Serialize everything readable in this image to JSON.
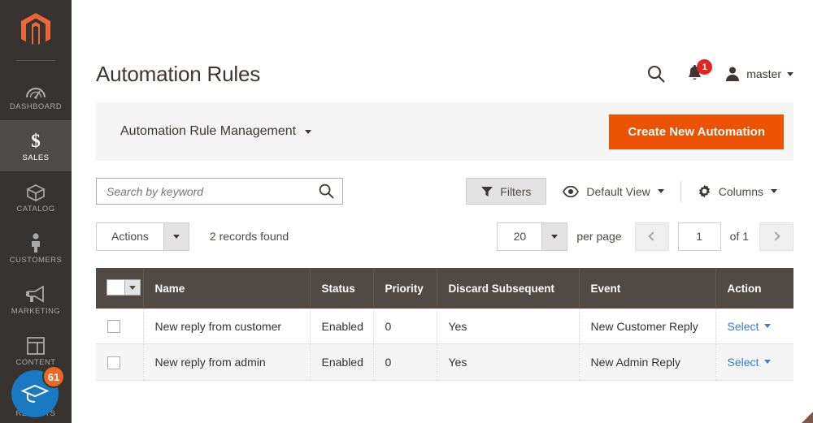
{
  "sidebar": {
    "logo_name": "magento-logo",
    "items": [
      {
        "label": "DASHBOARD",
        "icon": "gauge-icon",
        "active": false
      },
      {
        "label": "SALES",
        "icon": "dollar-icon",
        "active": true
      },
      {
        "label": "CATALOG",
        "icon": "box-icon",
        "active": false
      },
      {
        "label": "CUSTOMERS",
        "icon": "person-icon",
        "active": false
      },
      {
        "label": "MARKETING",
        "icon": "megaphone-icon",
        "active": false
      },
      {
        "label": "CONTENT",
        "icon": "layout-icon",
        "active": false
      },
      {
        "label": "REPORTS",
        "icon": "chart-icon",
        "active": false
      }
    ],
    "coach_badge": {
      "count": "61",
      "icon": "graduation-cap-icon",
      "color": "#1979c3",
      "badge_color": "#eb6726"
    }
  },
  "header": {
    "title": "Automation Rules",
    "search_icon": "search-icon",
    "notifications": {
      "icon": "bell-icon",
      "count": "1",
      "color": "#e22626"
    },
    "user": {
      "icon": "user-icon",
      "name": "master"
    }
  },
  "sub_panel": {
    "title": "Automation Rule Management",
    "create_button": "Create New Automation",
    "create_button_color": "#eb5202"
  },
  "toolbar": {
    "search_placeholder": "Search by keyword",
    "search_value": "",
    "filters_label": "Filters",
    "view_label": "Default View",
    "columns_label": "Columns"
  },
  "actions_row": {
    "actions_label": "Actions",
    "records_found": "2 records found",
    "per_page_value": "20",
    "per_page_label": "per page",
    "page_value": "1",
    "of_label": "of 1"
  },
  "grid": {
    "columns": [
      "Name",
      "Status",
      "Priority",
      "Discard Subsequent",
      "Event",
      "Action"
    ],
    "rows": [
      {
        "name": "New reply from customer",
        "status": "Enabled",
        "priority": "0",
        "discard_subsequent": "Yes",
        "event": "New Customer Reply",
        "action": "Select"
      },
      {
        "name": "New reply from admin",
        "status": "Enabled",
        "priority": "0",
        "discard_subsequent": "Yes",
        "event": "New Admin Reply",
        "action": "Select"
      }
    ]
  }
}
